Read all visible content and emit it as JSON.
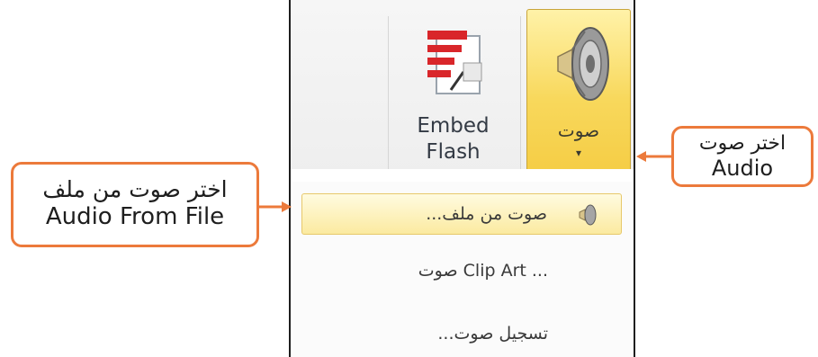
{
  "ribbon": {
    "embed_flash": {
      "label_line1": "Embed",
      "label_line2": "Flash"
    },
    "audio": {
      "label": "صوت",
      "dropdown_arrow": "▾"
    }
  },
  "menu": {
    "items": [
      {
        "label": "صوت من ملف...",
        "highlighted": true,
        "icon": "speaker-icon"
      },
      {
        "label": "صوت Clip Art ...",
        "highlighted": false
      },
      {
        "label": "تسجيل صوت...",
        "highlighted": false
      }
    ]
  },
  "callouts": {
    "left": {
      "line1": "اختر صوت من ملف",
      "line2": "Audio From File"
    },
    "right": {
      "line1": "اختر صوت",
      "line2": "Audio"
    }
  },
  "colors": {
    "callout_border": "#ec7a3b",
    "audio_button_fill": "#f8d85c",
    "menu_highlight": "#fbeaa0"
  }
}
